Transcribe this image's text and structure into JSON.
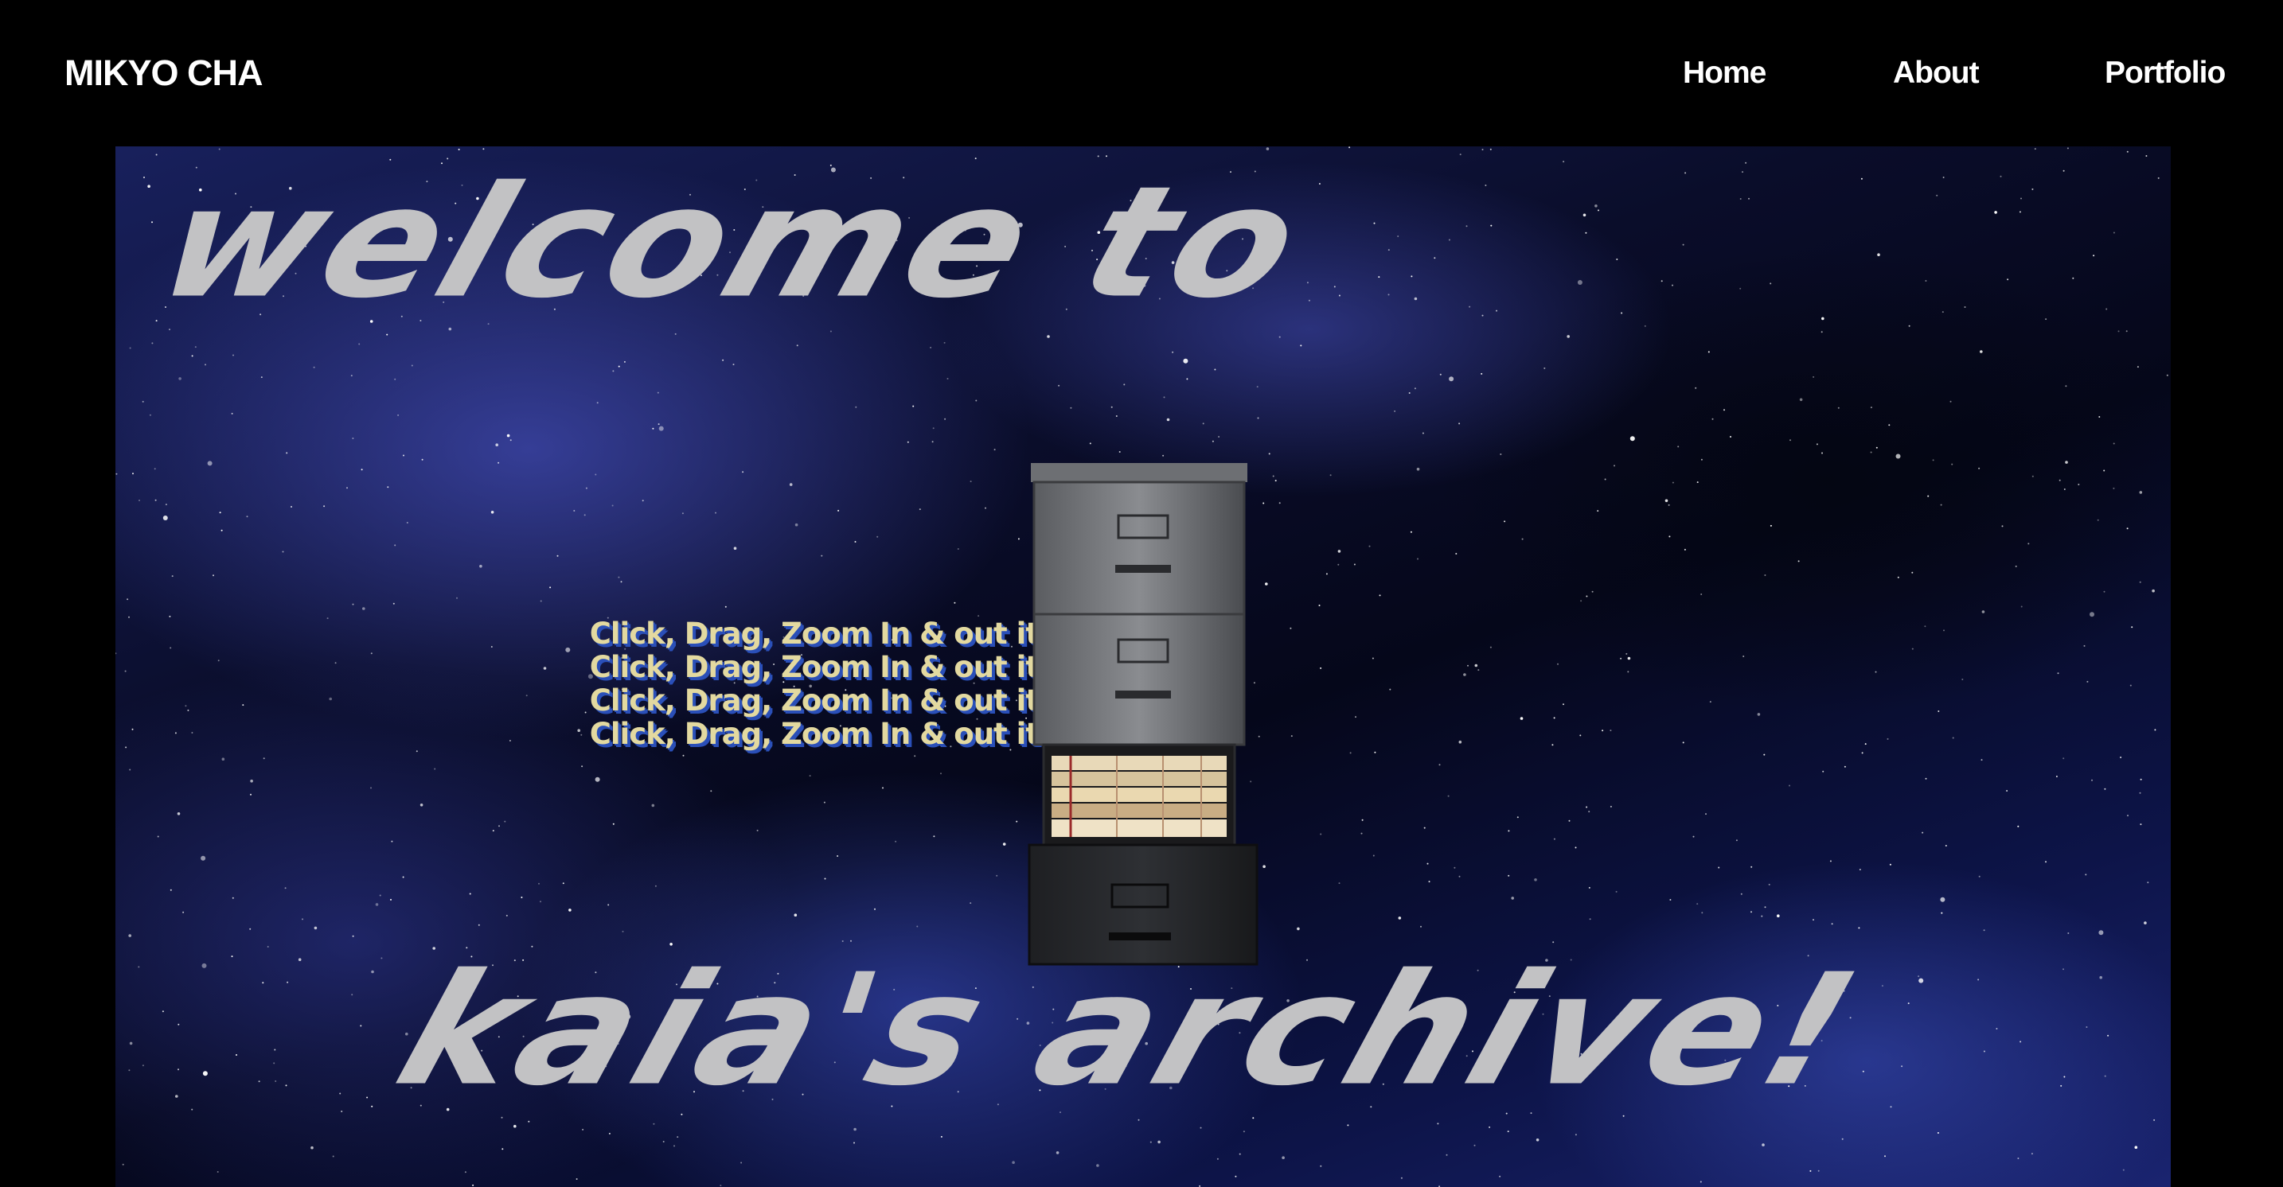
{
  "header": {
    "brand": "MIKYO CHA",
    "nav": {
      "home": "Home",
      "about": "About",
      "portfolio": "Portfolio"
    }
  },
  "stage": {
    "headline_top": "welcome to",
    "headline_bottom": "kaia's archive!",
    "instructions": [
      "Click, Drag, Zoom In & out it",
      "Click, Drag, Zoom In & out it",
      "Click, Drag, Zoom In & out it",
      "Click, Drag, Zoom In & out it"
    ],
    "object": "file-cabinet"
  },
  "colors": {
    "background": "#000000",
    "nav_text": "#ffffff",
    "headline": "#c2c2c4",
    "instruction_text": "#e3d9a0",
    "instruction_shadow": "#2a4fb8",
    "space_blue": "#1a2470"
  }
}
